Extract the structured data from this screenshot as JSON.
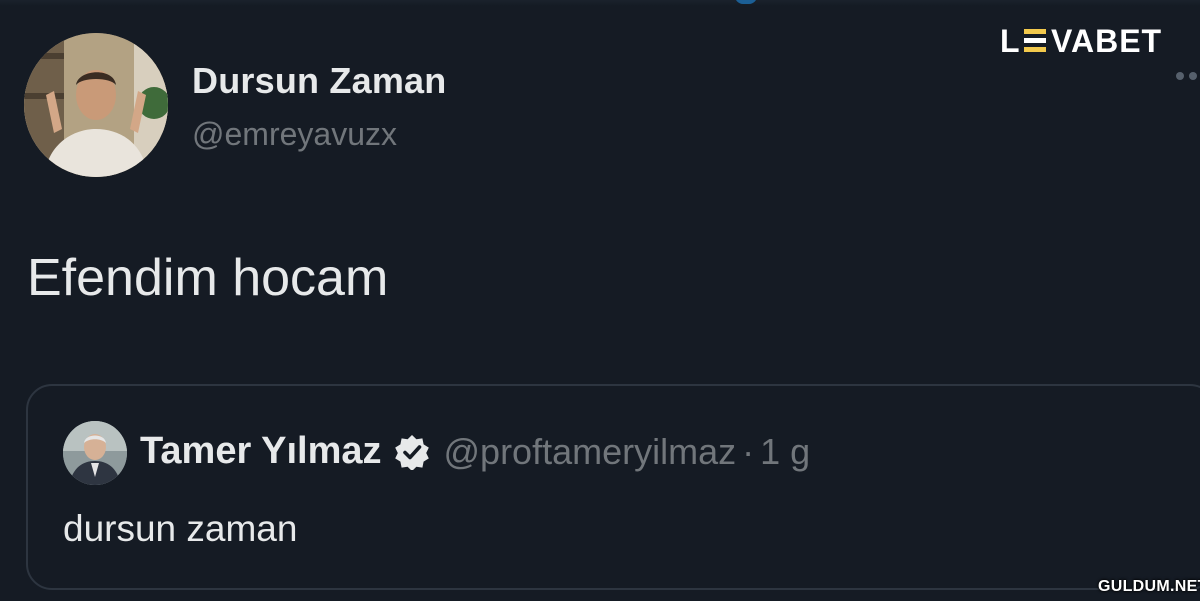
{
  "tweet": {
    "author": {
      "name": "Dursun Zaman",
      "handle": "@emreyavuzx",
      "avatar_icon": "profile-photo-icon"
    },
    "text": "Efendim hocam",
    "more_icon": "more-dots-icon"
  },
  "quoted_tweet": {
    "author": {
      "name": "Tamer Yılmaz",
      "handle": "@proftameryilmaz",
      "verified": true,
      "avatar_icon": "profile-photo-icon"
    },
    "separator": "·",
    "time": "1 g",
    "text": "dursun zaman"
  },
  "overlay": {
    "brand_logo": "LEVABET",
    "watermark": "GULDUM.NET"
  },
  "colors": {
    "background": "#151b24",
    "primary_text": "#e7e9ea",
    "secondary_text": "#71767b",
    "border": "#2d3540"
  }
}
